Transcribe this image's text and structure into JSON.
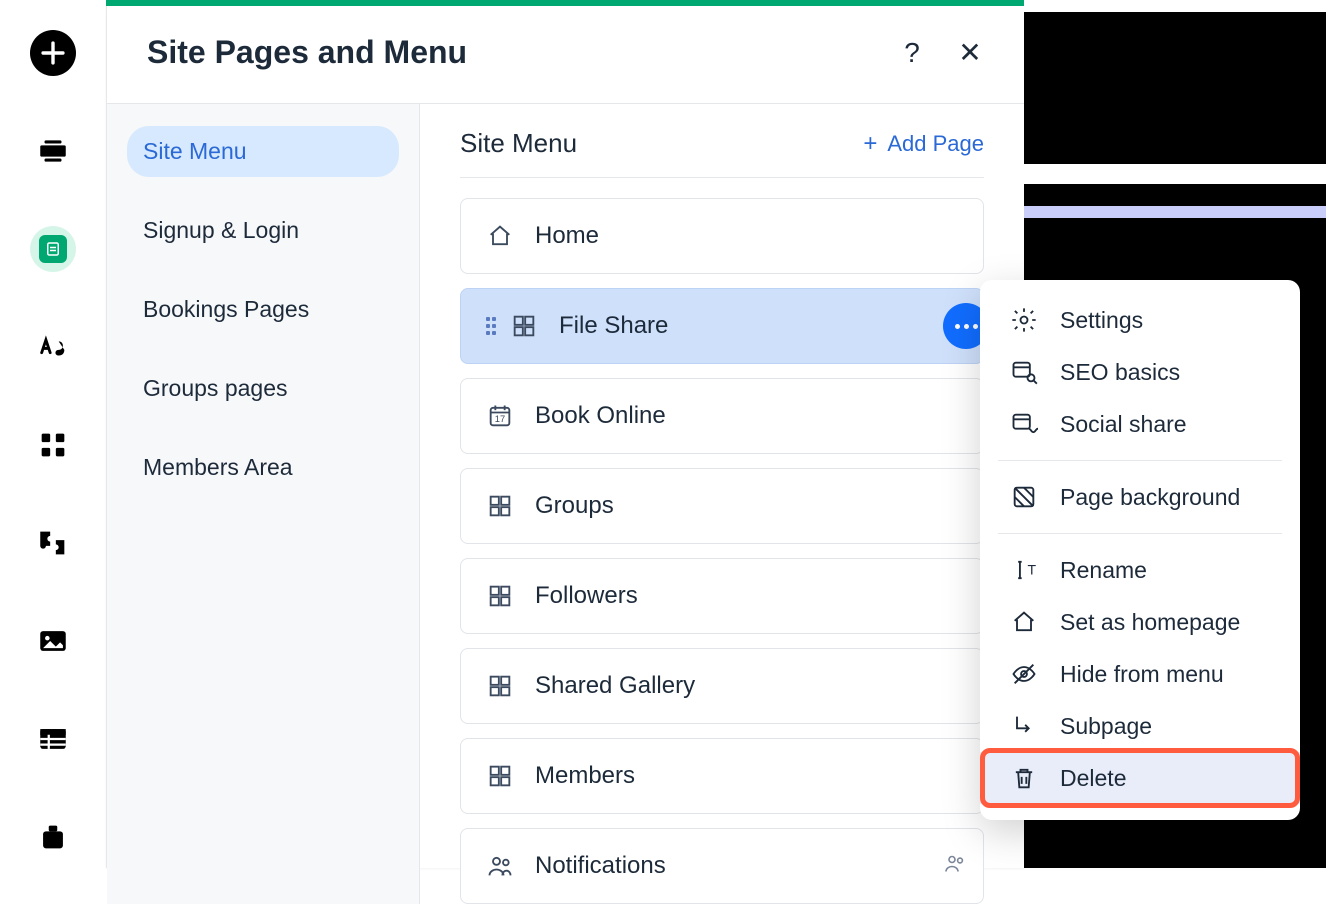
{
  "panel": {
    "title": "Site Pages and Menu",
    "help_tooltip": "Help",
    "close_tooltip": "Close"
  },
  "sidebar": {
    "items": [
      {
        "label": "Site Menu",
        "active": true
      },
      {
        "label": "Signup & Login",
        "active": false
      },
      {
        "label": "Bookings Pages",
        "active": false
      },
      {
        "label": "Groups pages",
        "active": false
      },
      {
        "label": "Members Area",
        "active": false
      }
    ]
  },
  "content": {
    "heading": "Site Menu",
    "add_page_label": "Add Page"
  },
  "pages": [
    {
      "label": "Home",
      "icon": "home",
      "selected": false
    },
    {
      "label": "File Share",
      "icon": "group-grid",
      "selected": true,
      "show_more": true
    },
    {
      "label": "Book Online",
      "icon": "calendar",
      "selected": false
    },
    {
      "label": "Groups",
      "icon": "group-grid",
      "selected": false
    },
    {
      "label": "Followers",
      "icon": "group-grid",
      "selected": false
    },
    {
      "label": "Shared Gallery",
      "icon": "group-grid",
      "selected": false
    },
    {
      "label": "Members",
      "icon": "group-grid",
      "selected": false
    },
    {
      "label": "Notifications",
      "icon": "people",
      "selected": false,
      "trailing_icon": "members"
    }
  ],
  "context_menu": {
    "items": [
      {
        "label": "Settings",
        "icon": "gear"
      },
      {
        "label": "SEO basics",
        "icon": "seo"
      },
      {
        "label": "Social share",
        "icon": "social"
      },
      {
        "sep": true
      },
      {
        "label": "Page background",
        "icon": "pattern"
      },
      {
        "sep": true
      },
      {
        "label": "Rename",
        "icon": "rename"
      },
      {
        "label": "Set as homepage",
        "icon": "home"
      },
      {
        "label": "Hide from menu",
        "icon": "hide"
      },
      {
        "label": "Subpage",
        "icon": "subpage"
      },
      {
        "label": "Delete",
        "icon": "trash",
        "highlight": true
      }
    ]
  },
  "railbar": {
    "items": [
      "add",
      "screens",
      "pages",
      "theme",
      "apps",
      "plugins",
      "media",
      "table",
      "store"
    ]
  }
}
